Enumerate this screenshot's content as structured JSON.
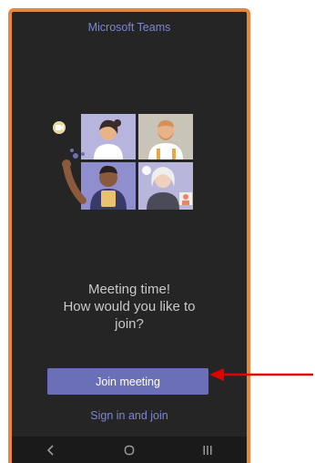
{
  "app": {
    "title": "Microsoft Teams"
  },
  "prompt": {
    "line1": "Meeting time!",
    "line2": "How would you like to",
    "line3": "join?"
  },
  "actions": {
    "join_label": "Join meeting",
    "signin_label": "Sign in and join"
  },
  "nav_bar": {
    "icons": [
      "back-icon",
      "home-icon",
      "recents-icon"
    ]
  },
  "colors": {
    "frame_border": "#e8863a",
    "screen_background": "#252525",
    "accent": "#6b6fb8",
    "link": "#7f85d0",
    "annotation_arrow": "#e00000"
  }
}
